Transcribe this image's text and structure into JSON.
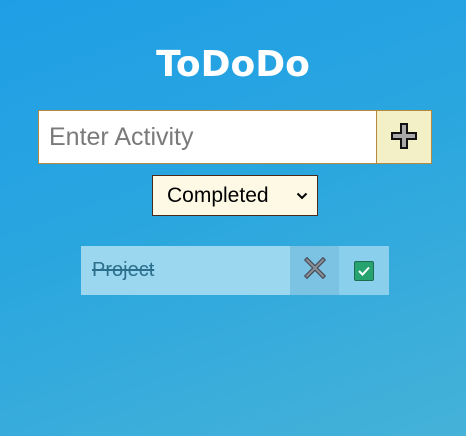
{
  "app": {
    "title": "ToDoDo"
  },
  "form": {
    "input_placeholder": "Enter Activity",
    "input_value": "",
    "add_icon": "plus-icon"
  },
  "filter": {
    "selected": "Completed",
    "icon": "chevron-down-icon"
  },
  "todos": [
    {
      "text": "Project",
      "completed": true,
      "delete_icon": "cross-icon",
      "complete_icon": "checkmark-icon"
    }
  ],
  "colors": {
    "background_start": "#1f9ee6",
    "background_end": "#45b2d8",
    "add_button_bg": "#f3efc7",
    "select_bg": "#fdf9e4",
    "item_bg": "#9bd8f0",
    "check_green": "#27a36f"
  }
}
